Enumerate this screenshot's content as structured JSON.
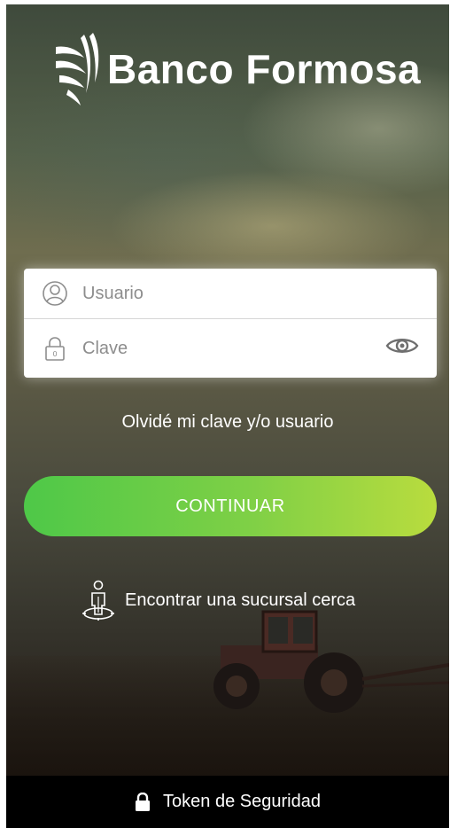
{
  "brand": {
    "name": "Banco Formosa"
  },
  "login": {
    "user_placeholder": "Usuario",
    "password_placeholder": "Clave"
  },
  "forgot_link": "Olvidé mi clave y/o usuario",
  "continue_button": "CONTINUAR",
  "branch_link": "Encontrar una sucursal cerca",
  "security_token": "Token de Seguridad",
  "icons": {
    "user": "user-circle-icon",
    "lock": "padlock-icon",
    "eye": "eye-icon",
    "branch": "person-location-icon",
    "bottom_lock": "lock-icon"
  },
  "colors": {
    "button_start": "#4ec848",
    "button_end": "#b9dc3e",
    "bottom_bar": "#000000"
  }
}
